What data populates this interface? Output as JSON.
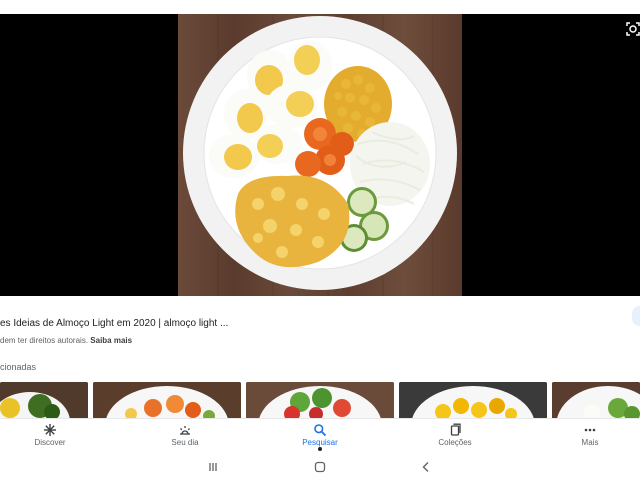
{
  "result": {
    "title": "es Ideias de Almoço Light em 2020 | almoço light ...",
    "copyright_text": "dem ter direitos autorais.",
    "learn_more": "Saiba mais"
  },
  "related": {
    "label": "cionadas"
  },
  "bottom_nav": {
    "items": [
      {
        "label": "Discover",
        "icon": "asterisk-icon"
      },
      {
        "label": "Seu dia",
        "icon": "weather-icon"
      },
      {
        "label": "Pesquisar",
        "icon": "search-icon",
        "active": true
      },
      {
        "label": "Coleções",
        "icon": "collections-icon"
      },
      {
        "label": "Mais",
        "icon": "more-dots-icon"
      }
    ]
  },
  "colors": {
    "accent": "#1a73e8",
    "text_secondary": "#5f6368",
    "viewer_background": "#000000"
  }
}
